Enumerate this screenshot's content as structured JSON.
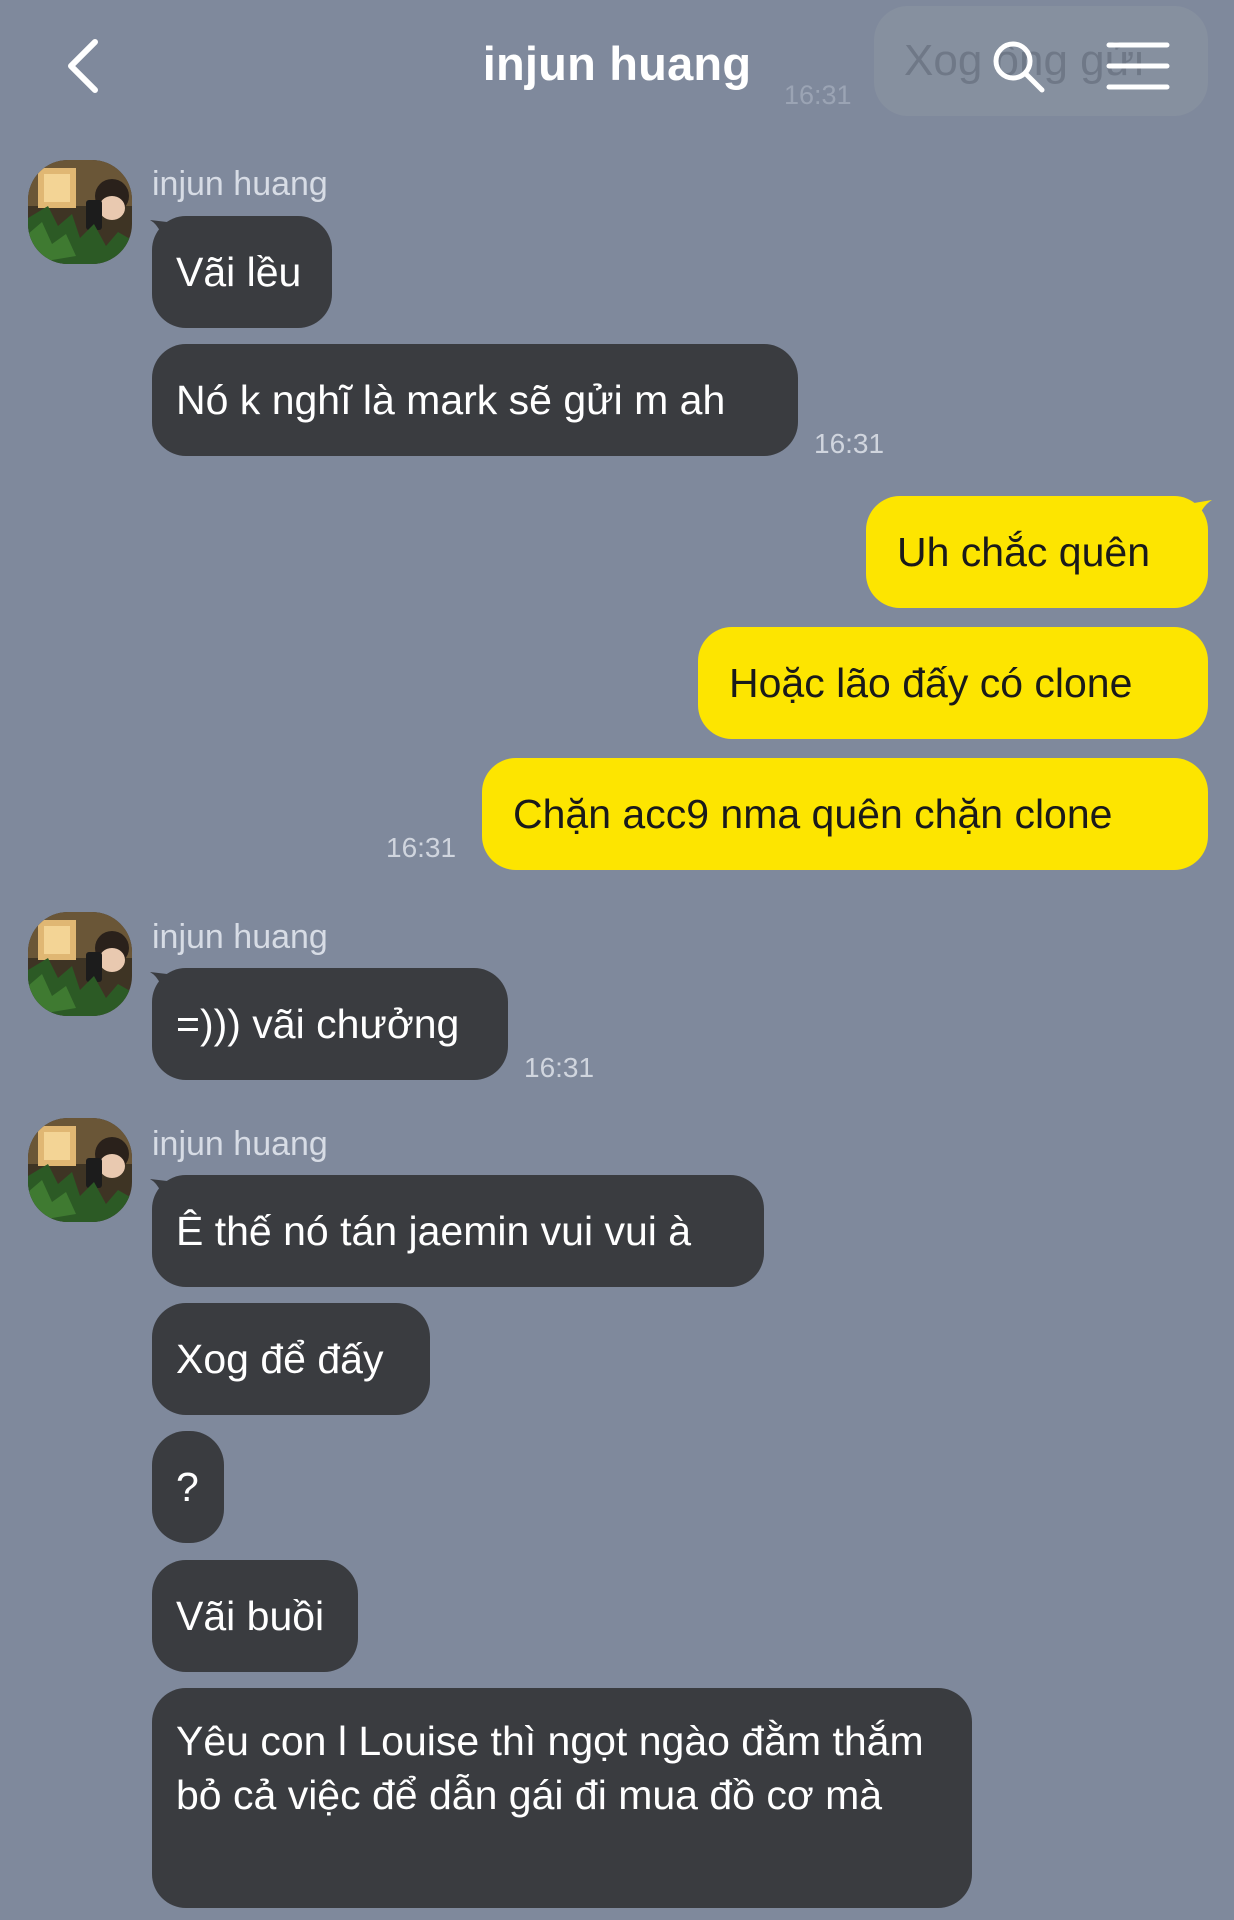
{
  "header": {
    "title": "injun huang",
    "ghost_preview_text": "Xog ông gửi",
    "ghost_preview_time": "16:31"
  },
  "messages": {
    "group1_sender": "injun huang",
    "m1": "Vãi lều",
    "m2": "Nó k nghĩ là mark sẽ gửi m ah",
    "m2_time": "16:31",
    "out1": "Uh chắc quên",
    "out2": "Hoặc lão đấy có clone",
    "out3": "Chặn acc9 nma quên chặn clone",
    "out3_time": "16:31",
    "group2_sender": "injun huang",
    "m3": "=))) vãi chưởng",
    "m3_time": "16:31",
    "group3_sender": "injun huang",
    "m4": "Ê thế nó tán jaemin vui vui à",
    "m5": "Xog để đấy",
    "m6": "?",
    "m7": "Vãi buồi",
    "m8": "Yêu con l Louise thì ngọt ngào đằm thắm bỏ cả việc để dẫn gái đi mua đồ cơ mà"
  },
  "colors": {
    "background": "#7f899c",
    "incoming_bubble": "#3a3c40",
    "outgoing_bubble": "#fde500"
  },
  "icons": {
    "back": "chevron-left-icon",
    "search": "search-icon",
    "menu": "hamburger-menu-icon"
  }
}
